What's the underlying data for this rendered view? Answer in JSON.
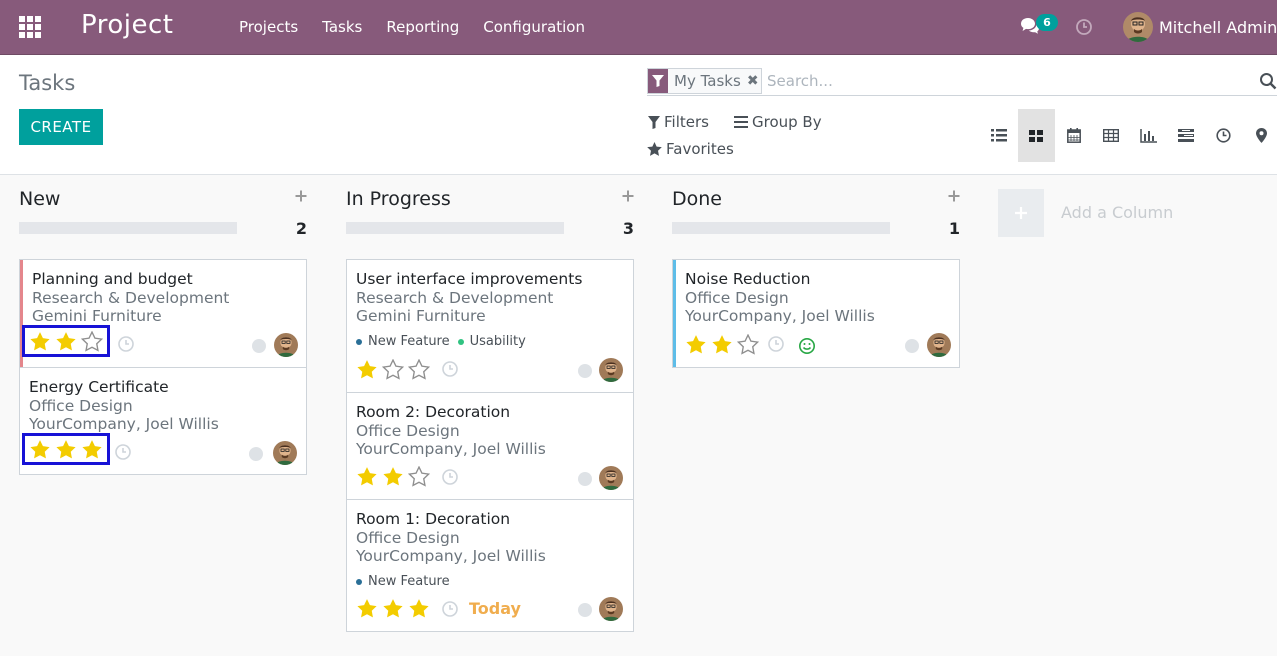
{
  "navbar": {
    "brand": "Project",
    "menu": [
      "Projects",
      "Tasks",
      "Reporting",
      "Configuration"
    ],
    "chat_count": "6",
    "user_name": "Mitchell Admin"
  },
  "control_panel": {
    "title": "Tasks",
    "create_label": "CREATE",
    "search": {
      "facet": "My Tasks",
      "placeholder": "Search..."
    },
    "filters_label": "Filters",
    "group_by_label": "Group By",
    "favorites_label": "Favorites",
    "views": [
      "list-icon",
      "kanban-icon",
      "calendar-icon",
      "pivot-icon",
      "graph-icon",
      "gantt-icon",
      "activity-icon",
      "map-icon"
    ],
    "active_view": "kanban-icon"
  },
  "kanban": {
    "columns": [
      {
        "title": "New",
        "count": "2",
        "cards": [
          {
            "title": "Planning and budget",
            "project": "Research & Development",
            "customer": "Gemini Furniture",
            "rating": 2,
            "highlight": true,
            "accent": "#e4868c"
          },
          {
            "title": "Energy Certificate",
            "project": "Office Design",
            "customer": "YourCompany, Joel Willis",
            "rating": 3,
            "highlight": true
          }
        ]
      },
      {
        "title": "In Progress",
        "count": "3",
        "cards": [
          {
            "title": "User interface improvements",
            "project": "Research & Development",
            "customer": "Gemini Furniture",
            "tags": [
              "New Feature",
              "Usability"
            ],
            "rating": 1
          },
          {
            "title": "Room 2: Decoration",
            "project": "Office Design",
            "customer": "YourCompany, Joel Willis",
            "rating": 2
          },
          {
            "title": "Room 1: Decoration",
            "project": "Office Design",
            "customer": "YourCompany, Joel Willis",
            "tags": [
              "New Feature"
            ],
            "rating": 3,
            "deadline": "Today"
          }
        ]
      },
      {
        "title": "Done",
        "count": "1",
        "cards": [
          {
            "title": "Noise Reduction",
            "project": "Office Design",
            "customer": "YourCompany, Joel Willis",
            "rating": 2,
            "accent": "#5ebde8",
            "smiley": true
          }
        ]
      }
    ],
    "add_column_label": "Add a Column"
  },
  "colors": {
    "brand": "#875a7b",
    "accent": "#00a09d",
    "star": "#f3cc00",
    "deadline": "#f0ad4e",
    "highlight_box": "#1712d6"
  }
}
